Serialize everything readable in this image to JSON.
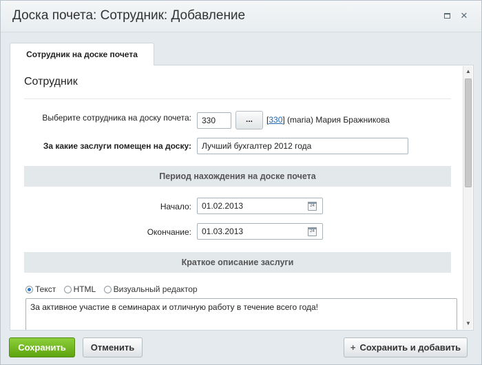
{
  "window": {
    "title": "Доска почета: Сотрудник: Добавление",
    "maximize_icon": "maximize-icon",
    "close_icon": "close-icon",
    "close_glyph": "✕"
  },
  "tabs": [
    {
      "label": "Сотрудник на доске почета",
      "active": true
    }
  ],
  "form": {
    "section_title": "Сотрудник",
    "employee": {
      "label": "Выберите сотрудника на доску почета:",
      "value": "330",
      "picker_label": "...",
      "info_prefix": "[",
      "info_link": "330",
      "info_suffix": "] (maria) Мария Бражникова"
    },
    "merits": {
      "label": "За какие заслуги помещен на доску:",
      "value": "Лучший бухгалтер 2012 года"
    },
    "period_header": "Период нахождения на доске почета",
    "start": {
      "label": "Начало:",
      "value": "01.02.2013",
      "icon": "calendar-icon",
      "icon_text": "24"
    },
    "end": {
      "label": "Окончание:",
      "value": "01.03.2013",
      "icon": "calendar-icon",
      "icon_text": "24"
    },
    "description_header": "Краткое описание заслуги",
    "editor_modes": [
      {
        "label": "Текст",
        "selected": true
      },
      {
        "label": "HTML",
        "selected": false
      },
      {
        "label": "Визуальный редактор",
        "selected": false
      }
    ],
    "description_text": "За активное участие в семинарах и отличную работу в течение всего года!"
  },
  "footer": {
    "save_label": "Сохранить",
    "cancel_label": "Отменить",
    "save_add_label": "Сохранить и добавить",
    "save_add_icon": "plus-icon",
    "save_add_glyph": "+"
  },
  "colors": {
    "save_button": "#6fb81f",
    "link": "#2167b0",
    "band": "#e3e8eb"
  }
}
